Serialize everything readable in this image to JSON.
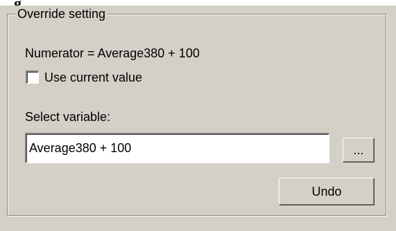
{
  "group": {
    "title": "Override setting"
  },
  "numerator_text": "Numerator = Average380 + 100",
  "use_current": {
    "label": "Use current value",
    "checked": false
  },
  "select_variable": {
    "label": "Select variable:",
    "value": "Average380 + 100",
    "browse_label": "..."
  },
  "undo_label": "Undo",
  "colors": {
    "panel_background": "#d4d0c8",
    "field_background": "#ffffff"
  }
}
